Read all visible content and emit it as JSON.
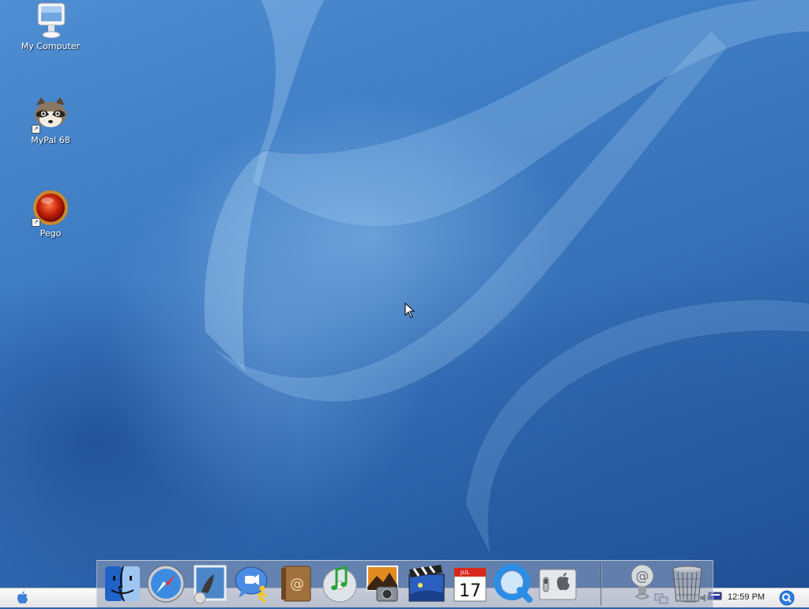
{
  "desktop": {
    "icons": [
      {
        "label": "My Computer"
      },
      {
        "label": "MyPal 68"
      },
      {
        "label": "Pego"
      }
    ]
  },
  "dock": {
    "apps": [
      {
        "icon": "finder-icon"
      },
      {
        "icon": "safari-icon"
      },
      {
        "icon": "mail-icon"
      },
      {
        "icon": "ichat-icon"
      },
      {
        "icon": "address-book-icon"
      },
      {
        "icon": "itunes-icon"
      },
      {
        "icon": "iphoto-icon"
      },
      {
        "icon": "imovie-icon"
      },
      {
        "icon": "ical-icon",
        "month": "JUL",
        "day": "17"
      },
      {
        "icon": "quicktime-icon"
      },
      {
        "icon": "system-preferences-icon"
      }
    ],
    "right_items": [
      {
        "icon": "internet-connect-icon"
      },
      {
        "icon": "trash-icon"
      }
    ]
  },
  "taskbar": {
    "clock": "12:59 PM"
  },
  "colors": {
    "wallpaper": "#3670b7",
    "taskbar": "#efefef",
    "dock": "#9aa0b9"
  }
}
